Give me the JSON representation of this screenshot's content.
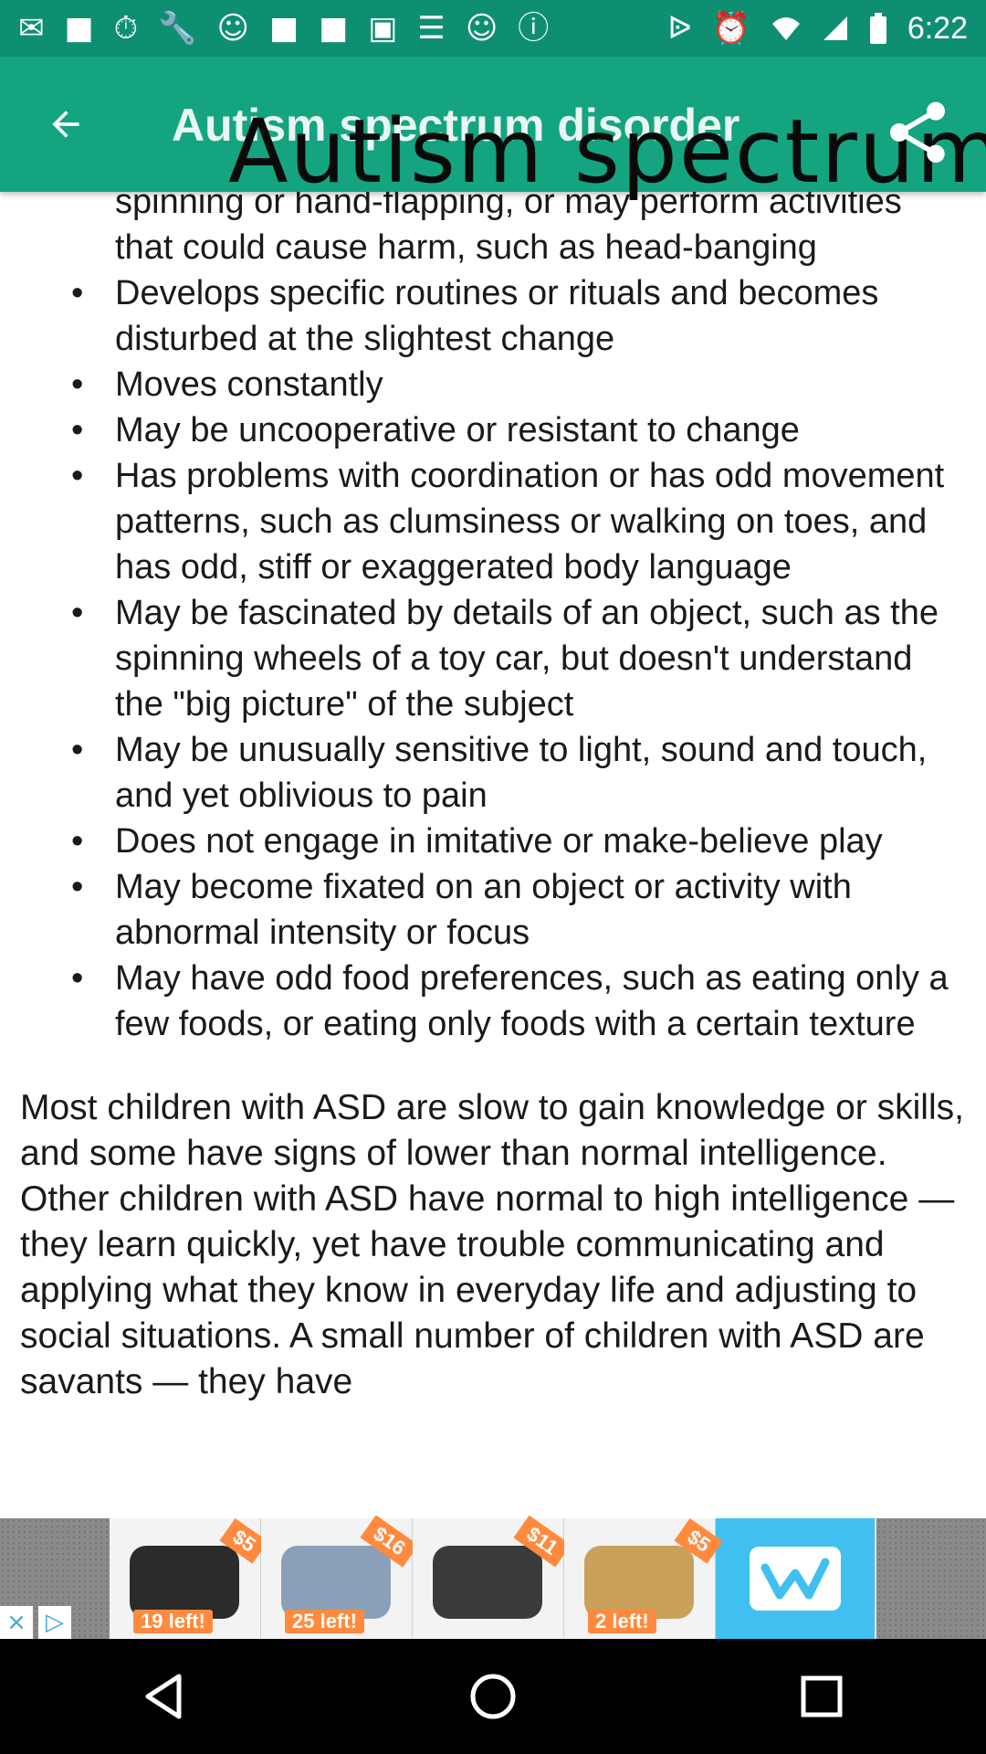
{
  "status_bar": {
    "time": "6:22",
    "left_icons": [
      "message-icon",
      "flipboard-icon",
      "timer-icon",
      "wrench-icon",
      "smiley-icon",
      "flipboard-icon",
      "flipboard-icon",
      "qt-icon",
      "news-icon",
      "smiley-icon",
      "info-icon"
    ],
    "right_icons": [
      "bluetooth-icon",
      "alarm-icon",
      "wifi-icon",
      "signal-icon",
      "battery-icon"
    ]
  },
  "app_bar": {
    "title": "Autism spectrum disorder",
    "overlay_text": "Autism spectrum",
    "background": "#14a480"
  },
  "content": {
    "bullets": [
      {
        "text": "spinning or hand-flapping, or may perform activities that could cause harm, such as head-banging",
        "bullet": false
      },
      {
        "text": "Develops specific routines or rituals and becomes disturbed at the slightest change",
        "bullet": true
      },
      {
        "text": "Moves constantly",
        "bullet": true
      },
      {
        "text": "May be uncooperative or resistant to change",
        "bullet": true
      },
      {
        "text": "Has problems with coordination or has odd movement patterns, such as clumsiness or walking on toes, and has odd, stiff or exaggerated body language",
        "bullet": true
      },
      {
        "text": "May be fascinated by details of an object, such as the spinning wheels of a toy car, but doesn't understand the \"big picture\" of the subject",
        "bullet": true
      },
      {
        "text": "May be unusually sensitive to light, sound and touch, and yet oblivious to pain",
        "bullet": true
      },
      {
        "text": "Does not engage in imitative or make-believe play",
        "bullet": true
      },
      {
        "text": "May become fixated on an object or activity with abnormal intensity or focus",
        "bullet": true
      },
      {
        "text": "May have odd food preferences, such as eating only a few foods, or eating only foods with a certain texture",
        "bullet": true
      }
    ],
    "paragraph": "Most children with ASD are slow to gain knowledge or skills, and some have signs of lower than normal intelligence. Other children with ASD have normal to high intelligence — they learn quickly, yet have trouble communicating and applying what they know in everyday life and adjusting to social situations. A small number of children with ASD are savants — they have"
  },
  "ad": {
    "products": [
      {
        "price": "$5",
        "stock": "19 left!"
      },
      {
        "price": "$16",
        "stock": "25 left!"
      },
      {
        "price": "$11",
        "stock": ""
      },
      {
        "price": "$5",
        "stock": "2 left!"
      }
    ],
    "logo": "w",
    "close_icon": "close-icon",
    "info_icon": "adchoices-icon"
  },
  "nav_bar": {
    "buttons": [
      "back-icon",
      "home-icon",
      "recents-icon"
    ]
  }
}
